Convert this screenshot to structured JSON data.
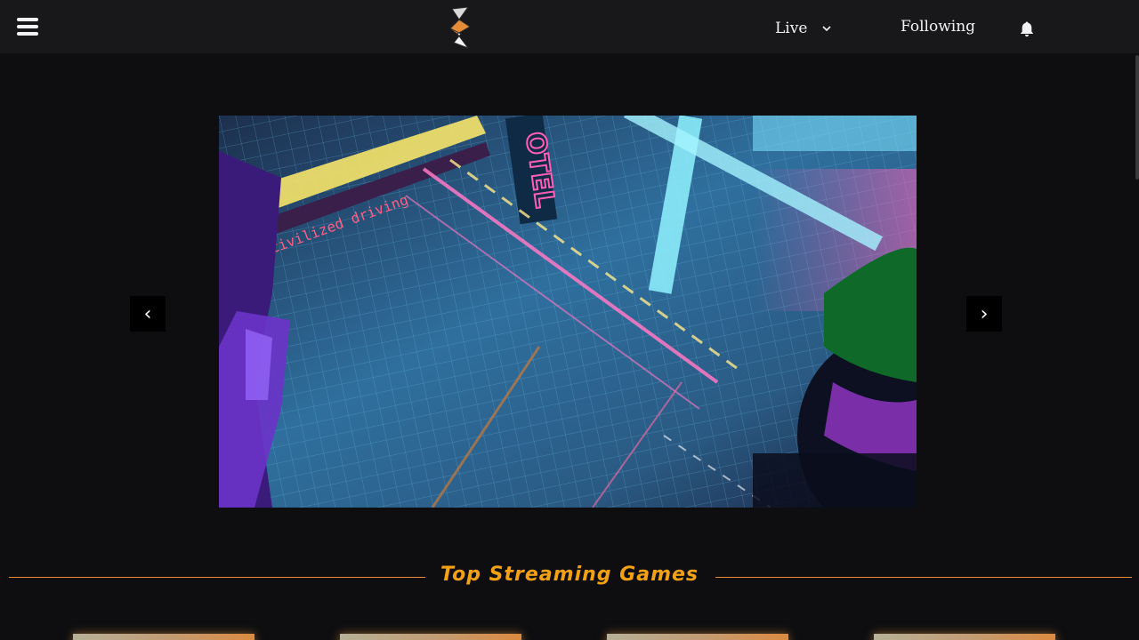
{
  "header": {
    "live_label": "Live",
    "following_label": "Following",
    "icons": [
      "hamburger-menu-icon",
      "logo-icon",
      "chevron-down-icon",
      "bell-icon"
    ]
  },
  "carousel": {
    "prev_label": "‹",
    "next_label": "›",
    "slide_sign_text": "OTEL",
    "slide_banner_text": "civilized driving"
  },
  "section": {
    "title": "Top Streaming Games"
  },
  "games": [
    {
      "name": "game-card-1"
    },
    {
      "name": "game-card-2"
    },
    {
      "name": "game-card-3"
    },
    {
      "name": "game-card-4"
    }
  ],
  "colors": {
    "background": "#0e0e10",
    "navbar": "#18181a",
    "accent_orange": "#f2a114",
    "divider": "#e58b3a",
    "text": "#f2f2f2"
  }
}
